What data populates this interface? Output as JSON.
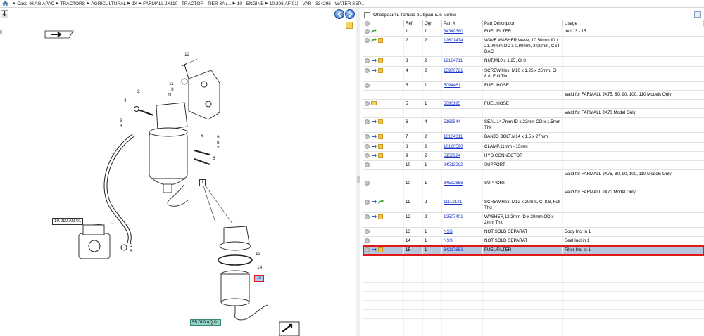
{
  "breadcrumb": {
    "items": [
      "Case IH AG APAC",
      "TRACTORS",
      "AGRICULTURAL",
      "JX",
      "FARMALL JX110 - TRACTOR - TIER 3A (...",
      "10 - ENGINE",
      "10.206.AF[01] - VAR - 334296 - WATER SEP..."
    ]
  },
  "diagram": {
    "callouts": {
      "ref_10210": "10.210.AO 01",
      "ref_55010": "55.010.AQ 01",
      "box_1": "1",
      "selected": "15"
    },
    "labels": [
      "12",
      "2",
      "11",
      "3",
      "10",
      "4",
      "9",
      "8",
      "7",
      "6",
      "9",
      "8",
      "7",
      "6",
      "5",
      "8",
      "13",
      "14"
    ]
  },
  "parts_panel": {
    "filter_label": "Отобразить только выбранные метки",
    "columns": [
      "",
      "Ref",
      "Qty",
      "Part #",
      "Part Description",
      "Usage"
    ],
    "rows": [
      {
        "icons": [
          "info",
          "green"
        ],
        "ref": "1",
        "qty": "1",
        "part": "84349380",
        "desc": "FUEL FILTER",
        "usage": "Incl 13 - 15"
      },
      {
        "icons": [
          "info",
          "green",
          "box"
        ],
        "ref": "2",
        "qty": "2",
        "part": "12601474",
        "desc": "WAVE WASHER,Wave, 10.50mm ID x 21.00mm OD x 0.80mm, 3.00mm, CST, DAC",
        "usage": ""
      },
      {
        "icons": [
          "info",
          "blue",
          "box"
        ],
        "ref": "3",
        "qty": "2",
        "part": "12164711",
        "desc": "NUT,M10 x 1.25, Cl 8",
        "usage": ""
      },
      {
        "icons": [
          "info",
          "blue",
          "box"
        ],
        "ref": "4",
        "qty": "2",
        "part": "15970721",
        "desc": "SCREW,Hex, M10 x 1.25 x 25mm, Cl 8.8, Full Thd",
        "usage": ""
      },
      {
        "icons": [
          "info"
        ],
        "ref": "5",
        "qty": "1",
        "part": "5094461",
        "desc": "FUEL HOSE",
        "usage": ""
      },
      {
        "note": "Valid for FARMALL JX75, 80, 90, 100, 110 Models Only"
      },
      {
        "icons": [
          "info",
          "folder"
        ],
        "ref": "5",
        "qty": "1",
        "part": "5090195",
        "desc": "FUEL HOSE",
        "usage": ""
      },
      {
        "note": "Valid for FARMALL JX70 Model Only"
      },
      {
        "icons": [
          "info",
          "blue",
          "box"
        ],
        "ref": "6",
        "qty": "4",
        "part": "5169544",
        "desc": "SEAL,14.7mm ID x 22mm OD x 1.5mm Thk",
        "usage": ""
      },
      {
        "icons": [
          "info",
          "blue",
          "box"
        ],
        "ref": "7",
        "qty": "2",
        "part": "16104311",
        "desc": "BANJO BOLT,M14 x 1.5 x 27mm",
        "usage": ""
      },
      {
        "icons": [
          "info",
          "blue",
          "box"
        ],
        "ref": "8",
        "qty": "2",
        "part": "16186590",
        "desc": "CLAMP,11mm - 13mm",
        "usage": ""
      },
      {
        "icons": [
          "info",
          "blue",
          "box"
        ],
        "ref": "9",
        "qty": "2",
        "part": "5150924",
        "desc": "HYD CONNECTOR",
        "usage": ""
      },
      {
        "icons": [
          "info"
        ],
        "ref": "10",
        "qty": "1",
        "part": "84512362",
        "desc": "SUPPORT",
        "usage": ""
      },
      {
        "note": "Valid for FARMALL JX75, 80, 90, 100, 110 Models Only"
      },
      {
        "icons": [
          "info"
        ],
        "ref": "10",
        "qty": "1",
        "part": "84592858",
        "desc": "SUPPORT",
        "usage": ""
      },
      {
        "note": "Valid for FARMALL JX70 Model Only"
      },
      {
        "icons": [
          "info",
          "blue",
          "green"
        ],
        "ref": "11",
        "qty": "2",
        "part": "11112121",
        "desc": "SCREW,Hex, M12 x 20mm, Cl 8.8, Full Thd",
        "usage": ""
      },
      {
        "icons": [
          "info",
          "blue",
          "box"
        ],
        "ref": "12",
        "qty": "2",
        "part": "12507401",
        "desc": "WASHER,12.2mm ID x 20mm OD x 2mm Thk",
        "usage": ""
      },
      {
        "icons": [
          "info"
        ],
        "ref": "13",
        "qty": "1",
        "part": "NSS",
        "desc": "NOT SOLD SEPARAT",
        "usage": "Body Incl in 1"
      },
      {
        "icons": [
          "info"
        ],
        "ref": "14",
        "qty": "1",
        "part": "NSS",
        "desc": "NOT SOLD SEPARAT",
        "usage": "Seal Incl in 1"
      },
      {
        "icons": [
          "info",
          "blue",
          "box"
        ],
        "ref": "15",
        "qty": "1",
        "part": "84217853",
        "desc": "FUEL FILTER",
        "usage": "Filter Incl in 1",
        "selected": true
      }
    ]
  }
}
